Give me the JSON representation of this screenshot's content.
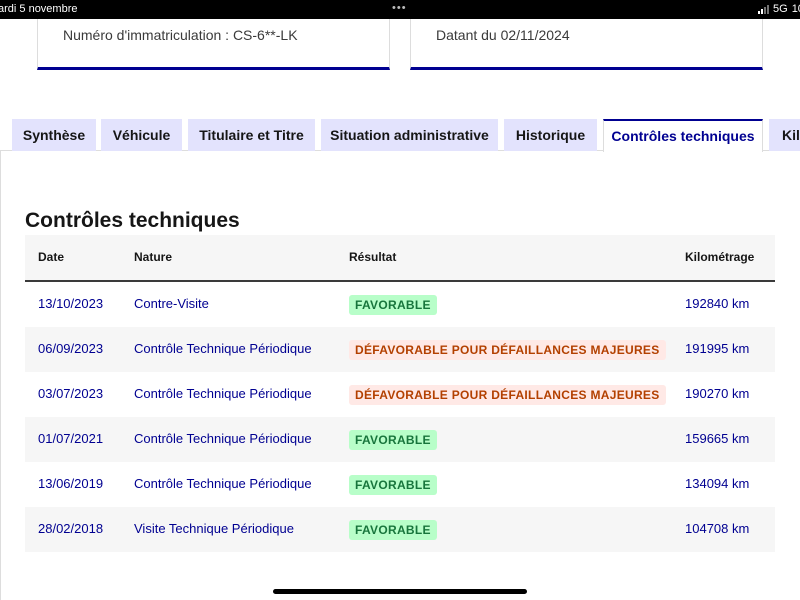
{
  "status_bar": {
    "date": "ardi 5 novembre",
    "dots": "•••",
    "network": "5G",
    "battery_fragment": "10"
  },
  "cards": {
    "registration": "Numéro d'immatriculation : CS-6**-LK",
    "dated": "Datant du 02/11/2024"
  },
  "tabs": [
    {
      "label": "Synthèse",
      "active": false
    },
    {
      "label": "Véhicule",
      "active": false
    },
    {
      "label": "Titulaire et Titre",
      "active": false
    },
    {
      "label": "Situation administrative",
      "active": false
    },
    {
      "label": "Historique",
      "active": false
    },
    {
      "label": "Contrôles techniques",
      "active": true
    },
    {
      "label": "Kilo",
      "active": false
    }
  ],
  "section": {
    "title": "Contrôles techniques"
  },
  "table": {
    "headers": {
      "date": "Date",
      "nature": "Nature",
      "result": "Résultat",
      "km": "Kilométrage"
    },
    "rows": [
      {
        "date": "13/10/2023",
        "nature": "Contre-Visite",
        "result": "FAVORABLE",
        "status": "ok",
        "km": "192840 km"
      },
      {
        "date": "06/09/2023",
        "nature": "Contrôle Technique Périodique",
        "result": "DÉFAVORABLE POUR DÉFAILLANCES MAJEURES",
        "status": "ko",
        "km": "191995 km"
      },
      {
        "date": "03/07/2023",
        "nature": "Contrôle Technique Périodique",
        "result": "DÉFAVORABLE POUR DÉFAILLANCES MAJEURES",
        "status": "ko",
        "km": "190270 km"
      },
      {
        "date": "01/07/2021",
        "nature": "Contrôle Technique Périodique",
        "result": "FAVORABLE",
        "status": "ok",
        "km": "159665 km"
      },
      {
        "date": "13/06/2019",
        "nature": "Contrôle Technique Périodique",
        "result": "FAVORABLE",
        "status": "ok",
        "km": "134094 km"
      },
      {
        "date": "28/02/2018",
        "nature": "Visite Technique Périodique",
        "result": "FAVORABLE",
        "status": "ok",
        "km": "104708 km"
      }
    ]
  },
  "colors": {
    "primary": "#000091",
    "tab_inactive_bg": "#e3e3fd",
    "success_bg": "#b8fec9",
    "success_text": "#18753c",
    "error_bg": "#ffe9e6",
    "error_text": "#b34000"
  }
}
